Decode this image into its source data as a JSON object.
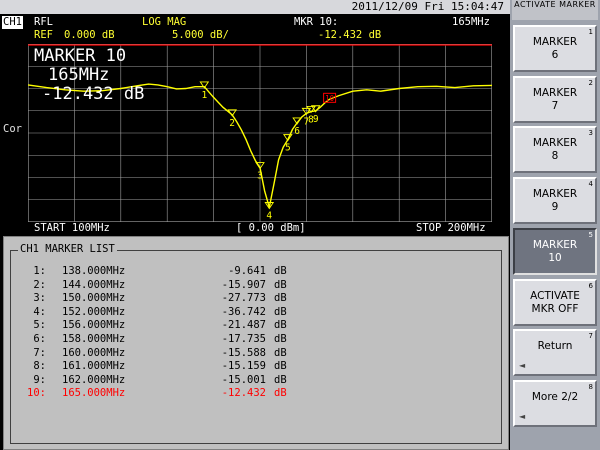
{
  "datetime": "2011/12/09 Fri 15:04:47",
  "header": {
    "channel": "CH1",
    "meas": "RFL",
    "format": "LOG MAG",
    "marker_hdr": "MKR 10:",
    "marker_freq_hdr": "165MHz",
    "ref_label": "REF",
    "ref_value": "0.000 dB",
    "scale": "5.000 dB/",
    "marker_value_hdr": "-12.432 dB",
    "cor": "Cor"
  },
  "marker_readout": {
    "title": "MARKER 10",
    "freq": "165MHz",
    "value": "-12.432 dB"
  },
  "footer": {
    "start": "START 100MHz",
    "power": "[ 0.00 dBm]",
    "stop": "STOP 200MHz"
  },
  "marker_list": {
    "title": "CH1 MARKER LIST",
    "rows": [
      {
        "num": "1:",
        "freq": "138.000MHz",
        "value": "-9.641",
        "unit": "dB"
      },
      {
        "num": "2:",
        "freq": "144.000MHz",
        "value": "-15.907",
        "unit": "dB"
      },
      {
        "num": "3:",
        "freq": "150.000MHz",
        "value": "-27.773",
        "unit": "dB"
      },
      {
        "num": "4:",
        "freq": "152.000MHz",
        "value": "-36.742",
        "unit": "dB"
      },
      {
        "num": "5:",
        "freq": "156.000MHz",
        "value": "-21.487",
        "unit": "dB"
      },
      {
        "num": "6:",
        "freq": "158.000MHz",
        "value": "-17.735",
        "unit": "dB"
      },
      {
        "num": "7:",
        "freq": "160.000MHz",
        "value": "-15.588",
        "unit": "dB"
      },
      {
        "num": "8:",
        "freq": "161.000MHz",
        "value": "-15.159",
        "unit": "dB"
      },
      {
        "num": "9:",
        "freq": "162.000MHz",
        "value": "-15.001",
        "unit": "dB"
      },
      {
        "num": "10:",
        "freq": "165.000MHz",
        "value": "-12.432",
        "unit": "dB"
      }
    ],
    "active_index": 9
  },
  "softkeys": {
    "title": "ACTIVATE MARKER",
    "keys": [
      {
        "label": "MARKER\n6",
        "num": "1",
        "arrow": ""
      },
      {
        "label": "MARKER\n7",
        "num": "2",
        "arrow": ""
      },
      {
        "label": "MARKER\n8",
        "num": "3",
        "arrow": ""
      },
      {
        "label": "MARKER\n9",
        "num": "4",
        "arrow": ""
      },
      {
        "label": "MARKER\n10",
        "num": "5",
        "arrow": ""
      },
      {
        "label": "ACTIVATE\nMKR OFF",
        "num": "6",
        "arrow": ""
      },
      {
        "label": "Return",
        "num": "7",
        "arrow": "◄"
      },
      {
        "label": "More 2/2",
        "num": "8",
        "arrow": "◄"
      }
    ],
    "selected_index": 4
  },
  "chart_data": {
    "type": "line",
    "xlim": [
      100,
      200
    ],
    "ylim": [
      -40,
      0
    ],
    "grid": true,
    "colors": {
      "trace": "#ffff00",
      "ref_line": "#ff0000",
      "grid": "#a0a0a0",
      "active_marker": "#ff0000"
    },
    "series": [
      {
        "x": [
          100,
          104,
          108,
          112,
          116,
          120,
          124,
          126,
          128,
          130,
          132,
          134,
          136,
          138,
          140,
          142,
          144,
          145,
          146,
          147,
          148,
          149,
          150,
          151,
          152,
          153,
          154,
          155,
          156,
          157,
          158,
          159,
          160,
          161,
          162,
          163,
          164,
          165,
          167,
          170,
          173,
          176,
          180,
          184,
          188,
          192,
          196,
          200
        ],
        "y": [
          -9.2,
          -9.8,
          -10.3,
          -10.6,
          -10.5,
          -10.0,
          -9.3,
          -9.0,
          -9.2,
          -9.6,
          -10.1,
          -10.0,
          -9.6,
          -9.6,
          -12.0,
          -14.2,
          -15.9,
          -17.5,
          -19.3,
          -21.5,
          -24.0,
          -26.2,
          -27.8,
          -33.0,
          -36.7,
          -31.5,
          -26.0,
          -23.2,
          -21.5,
          -19.2,
          -17.7,
          -16.4,
          -15.6,
          -15.2,
          -15.0,
          -14.2,
          -13.2,
          -12.4,
          -11.6,
          -10.6,
          -10.3,
          -10.6,
          -10.0,
          -9.6,
          -9.5,
          -9.8,
          -9.4,
          -9.3
        ]
      }
    ],
    "markers": [
      {
        "label": "1",
        "x": 138,
        "y": -9.641
      },
      {
        "label": "2",
        "x": 144,
        "y": -15.907
      },
      {
        "label": "3",
        "x": 150,
        "y": -27.773
      },
      {
        "label": "4",
        "x": 152,
        "y": -36.742
      },
      {
        "label": "5",
        "x": 156,
        "y": -21.487
      },
      {
        "label": "6",
        "x": 158,
        "y": -17.735
      },
      {
        "label": "7",
        "x": 160,
        "y": -15.588
      },
      {
        "label": "8",
        "x": 161,
        "y": -15.159
      },
      {
        "label": "9",
        "x": 162,
        "y": -15.001
      },
      {
        "label": "10",
        "x": 165,
        "y": -12.432
      }
    ]
  }
}
